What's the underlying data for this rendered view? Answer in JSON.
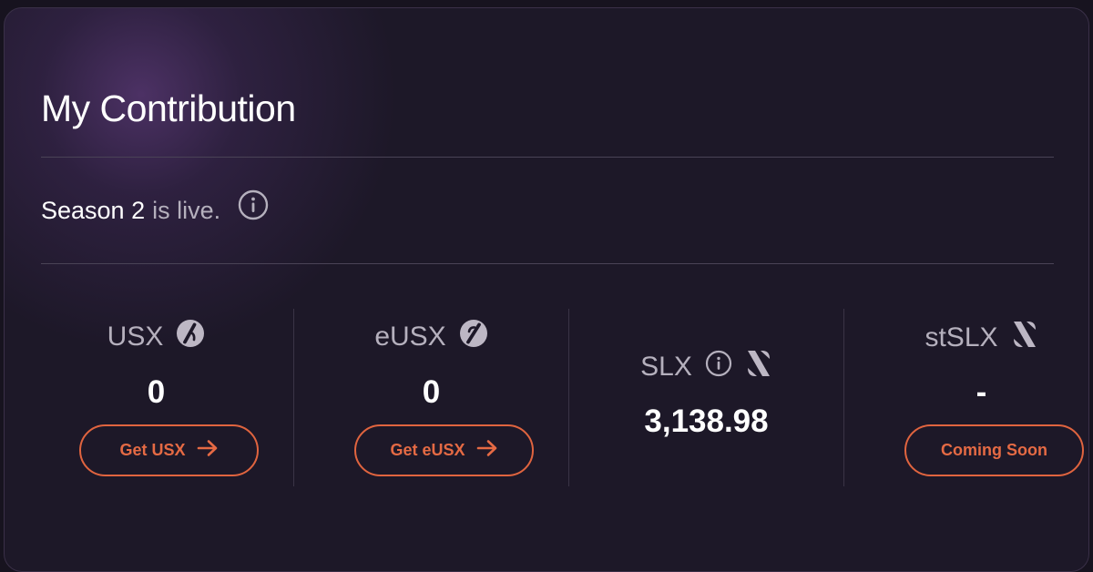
{
  "card": {
    "title": "My Contribution",
    "season": {
      "strong": "Season 2",
      "muted": "is live."
    }
  },
  "stats": {
    "usx": {
      "label": "USX",
      "value": "0",
      "button": "Get USX"
    },
    "eusx": {
      "label": "eUSX",
      "value": "0",
      "button": "Get eUSX"
    },
    "slx": {
      "label": "SLX",
      "value": "3,138.98"
    },
    "stslx": {
      "label": "stSLX",
      "value": "-",
      "button": "Coming Soon"
    }
  },
  "colors": {
    "background": "#1d1828",
    "accent": "#e0643f",
    "muted_text": "#b5b0bd",
    "divider": "#4a4356"
  },
  "icons": {
    "info": "info-circle-icon",
    "usx": "usx-token-icon",
    "eusx": "eusx-token-icon",
    "slx": "slx-token-icon",
    "stslx": "stslx-token-icon",
    "arrow": "arrow-right-icon"
  }
}
